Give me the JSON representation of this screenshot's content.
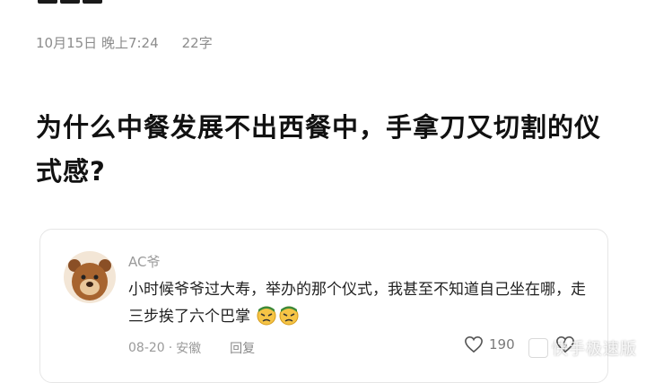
{
  "post": {
    "date": "10月15日 晚上7:24",
    "word_count": "22字",
    "title": "为什么中餐发展不出西餐中，手拿刀又切割的仪式感?"
  },
  "comment": {
    "username": "AC爷",
    "text": "小时候爷爷过大寿，举办的那个仪式，我甚至不知道自己坐在哪，走三步挨了六个巴掌",
    "date": "08-20",
    "location": "安徽",
    "meta_sep": "·",
    "reply_label": "回复",
    "like_count": "190",
    "emoji_count": 2
  },
  "watermark": {
    "text": "快手极速版"
  },
  "colors": {
    "meta_gray": "#8c8c8c",
    "title": "#111111",
    "card_border": "#e6e6e6"
  }
}
